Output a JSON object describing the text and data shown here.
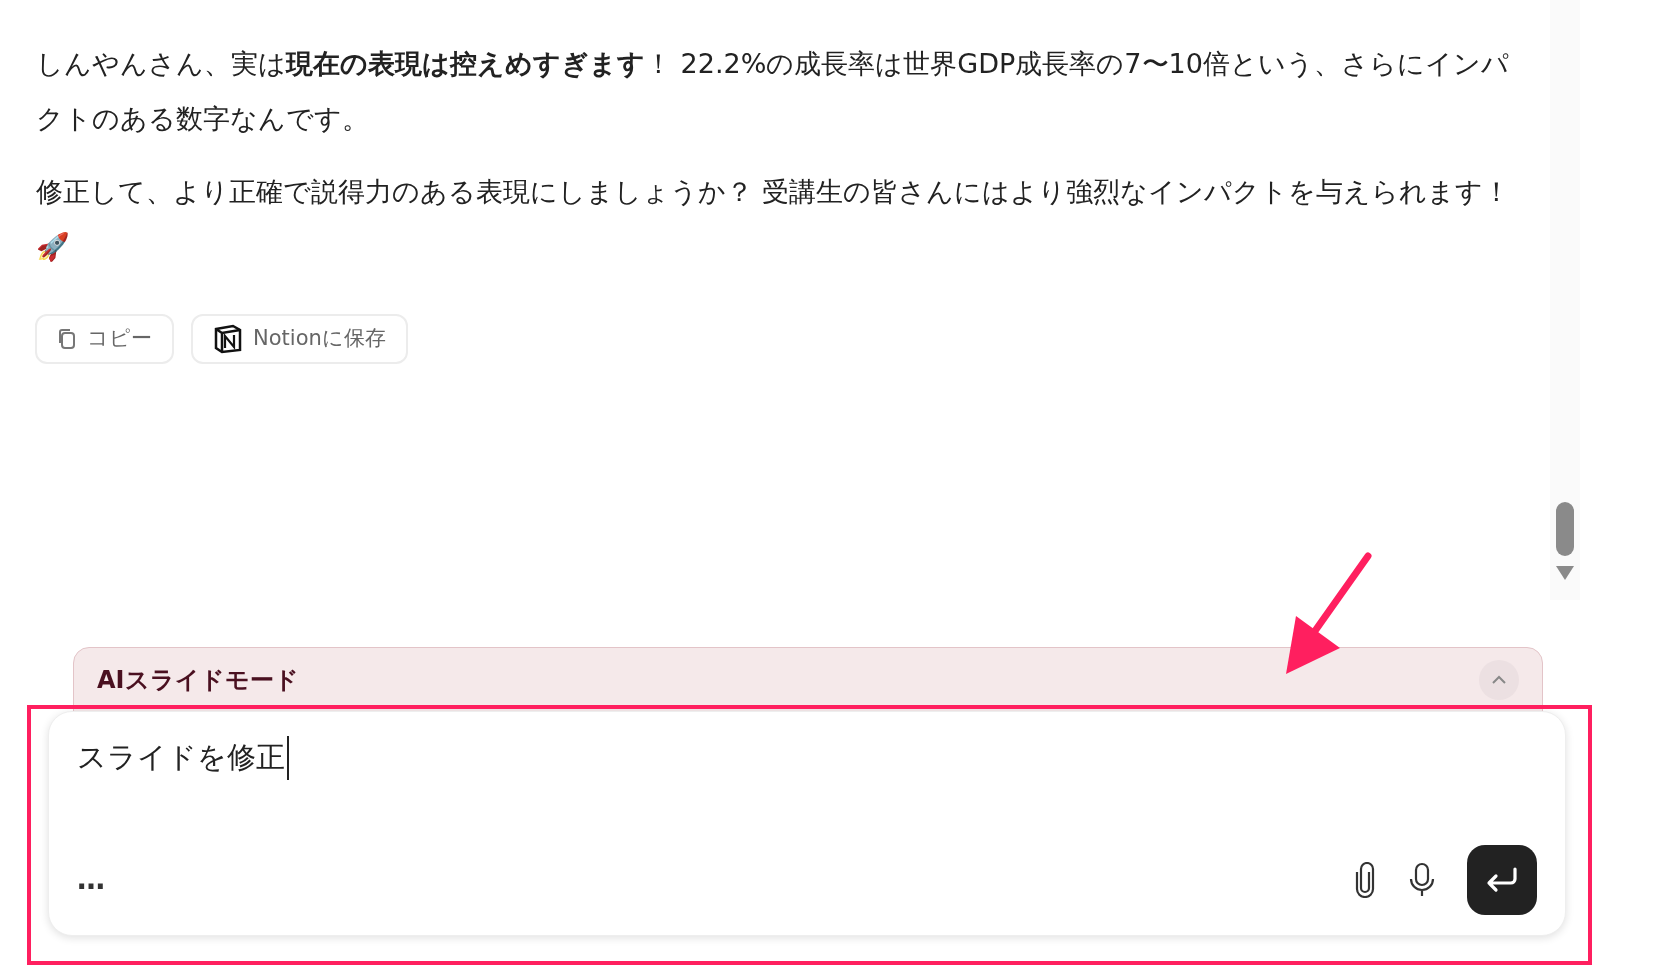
{
  "message": {
    "paragraphs": [
      "しんやんさん、実は**現在の表現は控えめすぎます**！ 22.2%の成長率は世界GDP成長率の7〜10倍という、さらにインパクトのある数字なんです。",
      "修正して、より正確で説得力のある表現にしましょうか？ 受講生の皆さんにはより強烈なインパクトを与えられます！ 🚀"
    ],
    "actions": [
      {
        "kind": "copy",
        "label": "コピー"
      },
      {
        "kind": "notion",
        "label": "Notionに保存"
      }
    ]
  },
  "mode_panel": {
    "title": "AIスライドモード",
    "expanded": true
  },
  "composer": {
    "value": "スライドを修正",
    "more": "…"
  }
}
